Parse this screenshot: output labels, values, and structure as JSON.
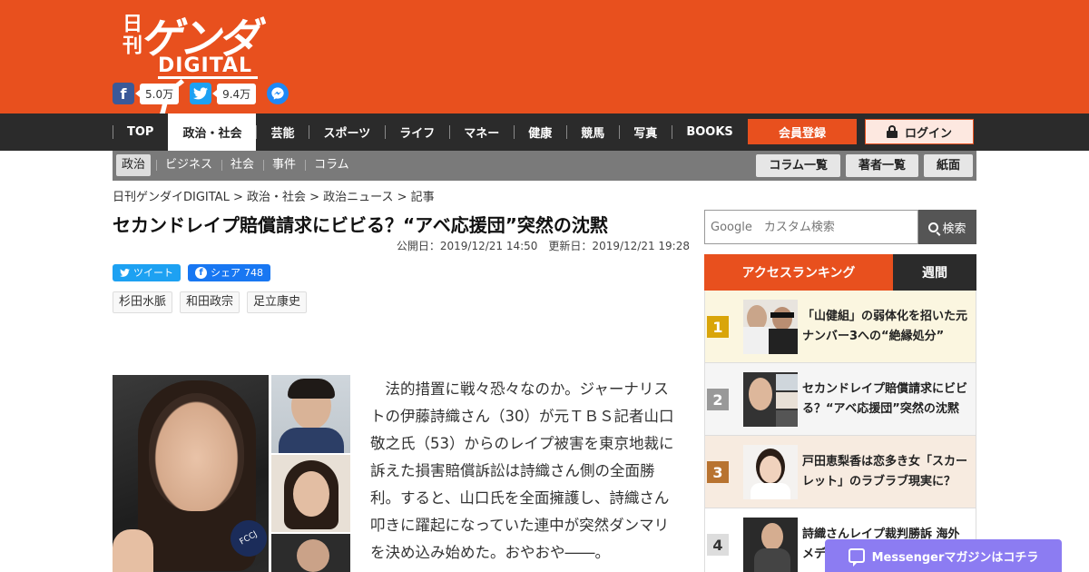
{
  "header": {
    "logo": {
      "nikkan": "日刊",
      "gendai": "ゲンダイ",
      "digital": "DIGITAL"
    },
    "social": {
      "facebook_count": "5.0万",
      "twitter_count": "9.4万",
      "facebook_icon": "f",
      "twitter_icon": "t"
    }
  },
  "main_nav": {
    "items": [
      "TOP",
      "政治・社会",
      "芸能",
      "スポーツ",
      "ライフ",
      "マネー",
      "健康",
      "競馬",
      "写真",
      "BOOKS"
    ],
    "active_index": 1,
    "register_label": "会員登録",
    "login_label": "ログイン"
  },
  "sub_nav": {
    "items": [
      "政治",
      "ビジネス",
      "社会",
      "事件",
      "コラム"
    ],
    "active_index": 0,
    "buttons": [
      "コラム一覧",
      "著者一覧",
      "紙面"
    ]
  },
  "breadcrumb": "日刊ゲンダイDIGITAL > 政治・社会 > 政治ニュース > 記事",
  "article": {
    "title": "セカンドレイプ賠償請求にビビる？“アベ応援団”突然の沈黙",
    "dates": "公開日：2019/12/21 14:50　更新日：2019/12/21 19:28",
    "tweet_label": "ツイート",
    "share_label": "シェア",
    "share_count": "748",
    "tags": [
      "杉田水脈",
      "和田政宗",
      "足立康史"
    ],
    "photo_mic_text": "FCCJ",
    "body": "法的措置に戦々恐々なのか。ジャーナリストの伊藤詩織さん（30）が元ＴＢＳ記者山口敬之氏（53）からのレイプ被害を東京地裁に訴えた損害賠償訴訟は詩織さん側の全面勝利。すると、山口氏を全面擁護し、詩織さん叩きに躍起になっていた連中が突然ダンマリを決め込み始めた。おやおや――。"
  },
  "sidebar": {
    "search_placeholder": "Google　カスタム検索",
    "search_button": "検索",
    "ranking_tab": "アクセスランキング",
    "weekly_tab": "週間",
    "ranking": [
      {
        "num": "1",
        "text": "「山健組」の弱体化を招いた元ナンバー3への“絶縁処分”"
      },
      {
        "num": "2",
        "text": "セカンドレイプ賠償請求にビビる？“アベ応援団”突然の沈黙"
      },
      {
        "num": "3",
        "text": "戸田恵梨香は恋多き女「スカーレット」のラブラブ現実に？"
      },
      {
        "num": "4",
        "text": "詩織さんレイプ裁判勝訴 海外メディ"
      }
    ]
  },
  "messenger_bar": "Messengerマガジンはコチラ"
}
